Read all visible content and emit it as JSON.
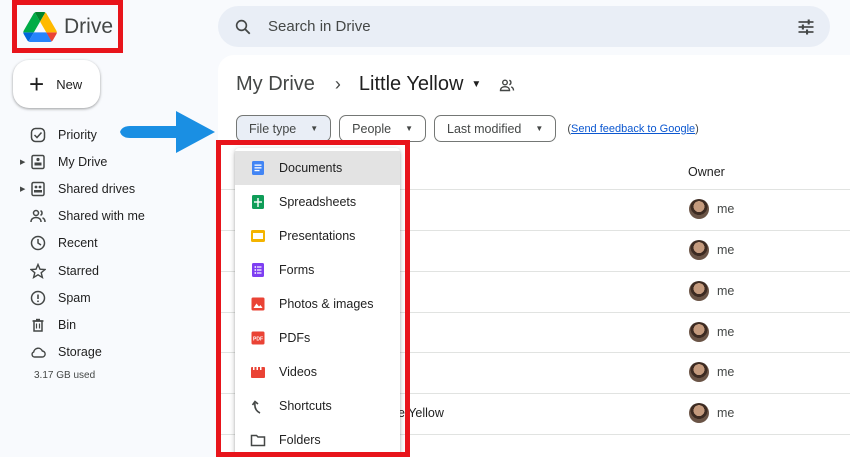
{
  "app": {
    "name": "Drive"
  },
  "search": {
    "placeholder": "Search in Drive"
  },
  "new_button": {
    "label": "New"
  },
  "sidebar": {
    "items": [
      {
        "label": "Priority",
        "icon": "priority-icon"
      },
      {
        "label": "My Drive",
        "icon": "my-drive-icon"
      },
      {
        "label": "Shared drives",
        "icon": "shared-drives-icon"
      },
      {
        "label": "Shared with me",
        "icon": "shared-with-me-icon"
      },
      {
        "label": "Recent",
        "icon": "recent-icon"
      },
      {
        "label": "Starred",
        "icon": "star-icon"
      },
      {
        "label": "Spam",
        "icon": "spam-icon"
      },
      {
        "label": "Bin",
        "icon": "bin-icon"
      },
      {
        "label": "Storage",
        "icon": "cloud-icon"
      }
    ],
    "storage_used": "3.17 GB used"
  },
  "breadcrumb": {
    "root": "My Drive",
    "current": "Little Yellow"
  },
  "filters": {
    "file_type": "File type",
    "people": "People",
    "last_modified": "Last modified",
    "feedback_open": "(",
    "feedback_link": "Send feedback to Google",
    "feedback_close": ")"
  },
  "table": {
    "owner_header": "Owner",
    "rows": [
      {
        "name": "",
        "owner": "me"
      },
      {
        "name": "",
        "owner": "me"
      },
      {
        "name": "",
        "owner": "me"
      },
      {
        "name": "",
        "owner": "me"
      },
      {
        "name": "",
        "owner": "me"
      },
      {
        "name": "e Yellow",
        "owner": "me"
      }
    ]
  },
  "file_type_menu": {
    "items": [
      {
        "label": "Documents",
        "icon": "docs-icon",
        "color": "#4285f4"
      },
      {
        "label": "Spreadsheets",
        "icon": "sheets-icon",
        "color": "#0f9d58"
      },
      {
        "label": "Presentations",
        "icon": "slides-icon",
        "color": "#f4b400"
      },
      {
        "label": "Forms",
        "icon": "forms-icon",
        "color": "#7e3ff2"
      },
      {
        "label": "Photos & images",
        "icon": "image-icon",
        "color": "#ea4335"
      },
      {
        "label": "PDFs",
        "icon": "pdf-icon",
        "color": "#ea4335"
      },
      {
        "label": "Videos",
        "icon": "video-icon",
        "color": "#ea4335"
      },
      {
        "label": "Shortcuts",
        "icon": "shortcut-icon",
        "color": "#444746"
      },
      {
        "label": "Folders",
        "icon": "folder-icon",
        "color": "#444746"
      }
    ]
  },
  "colors": {
    "highlight": "#e8141b",
    "arrow": "#1a8fe3",
    "link": "#0b57d0"
  }
}
